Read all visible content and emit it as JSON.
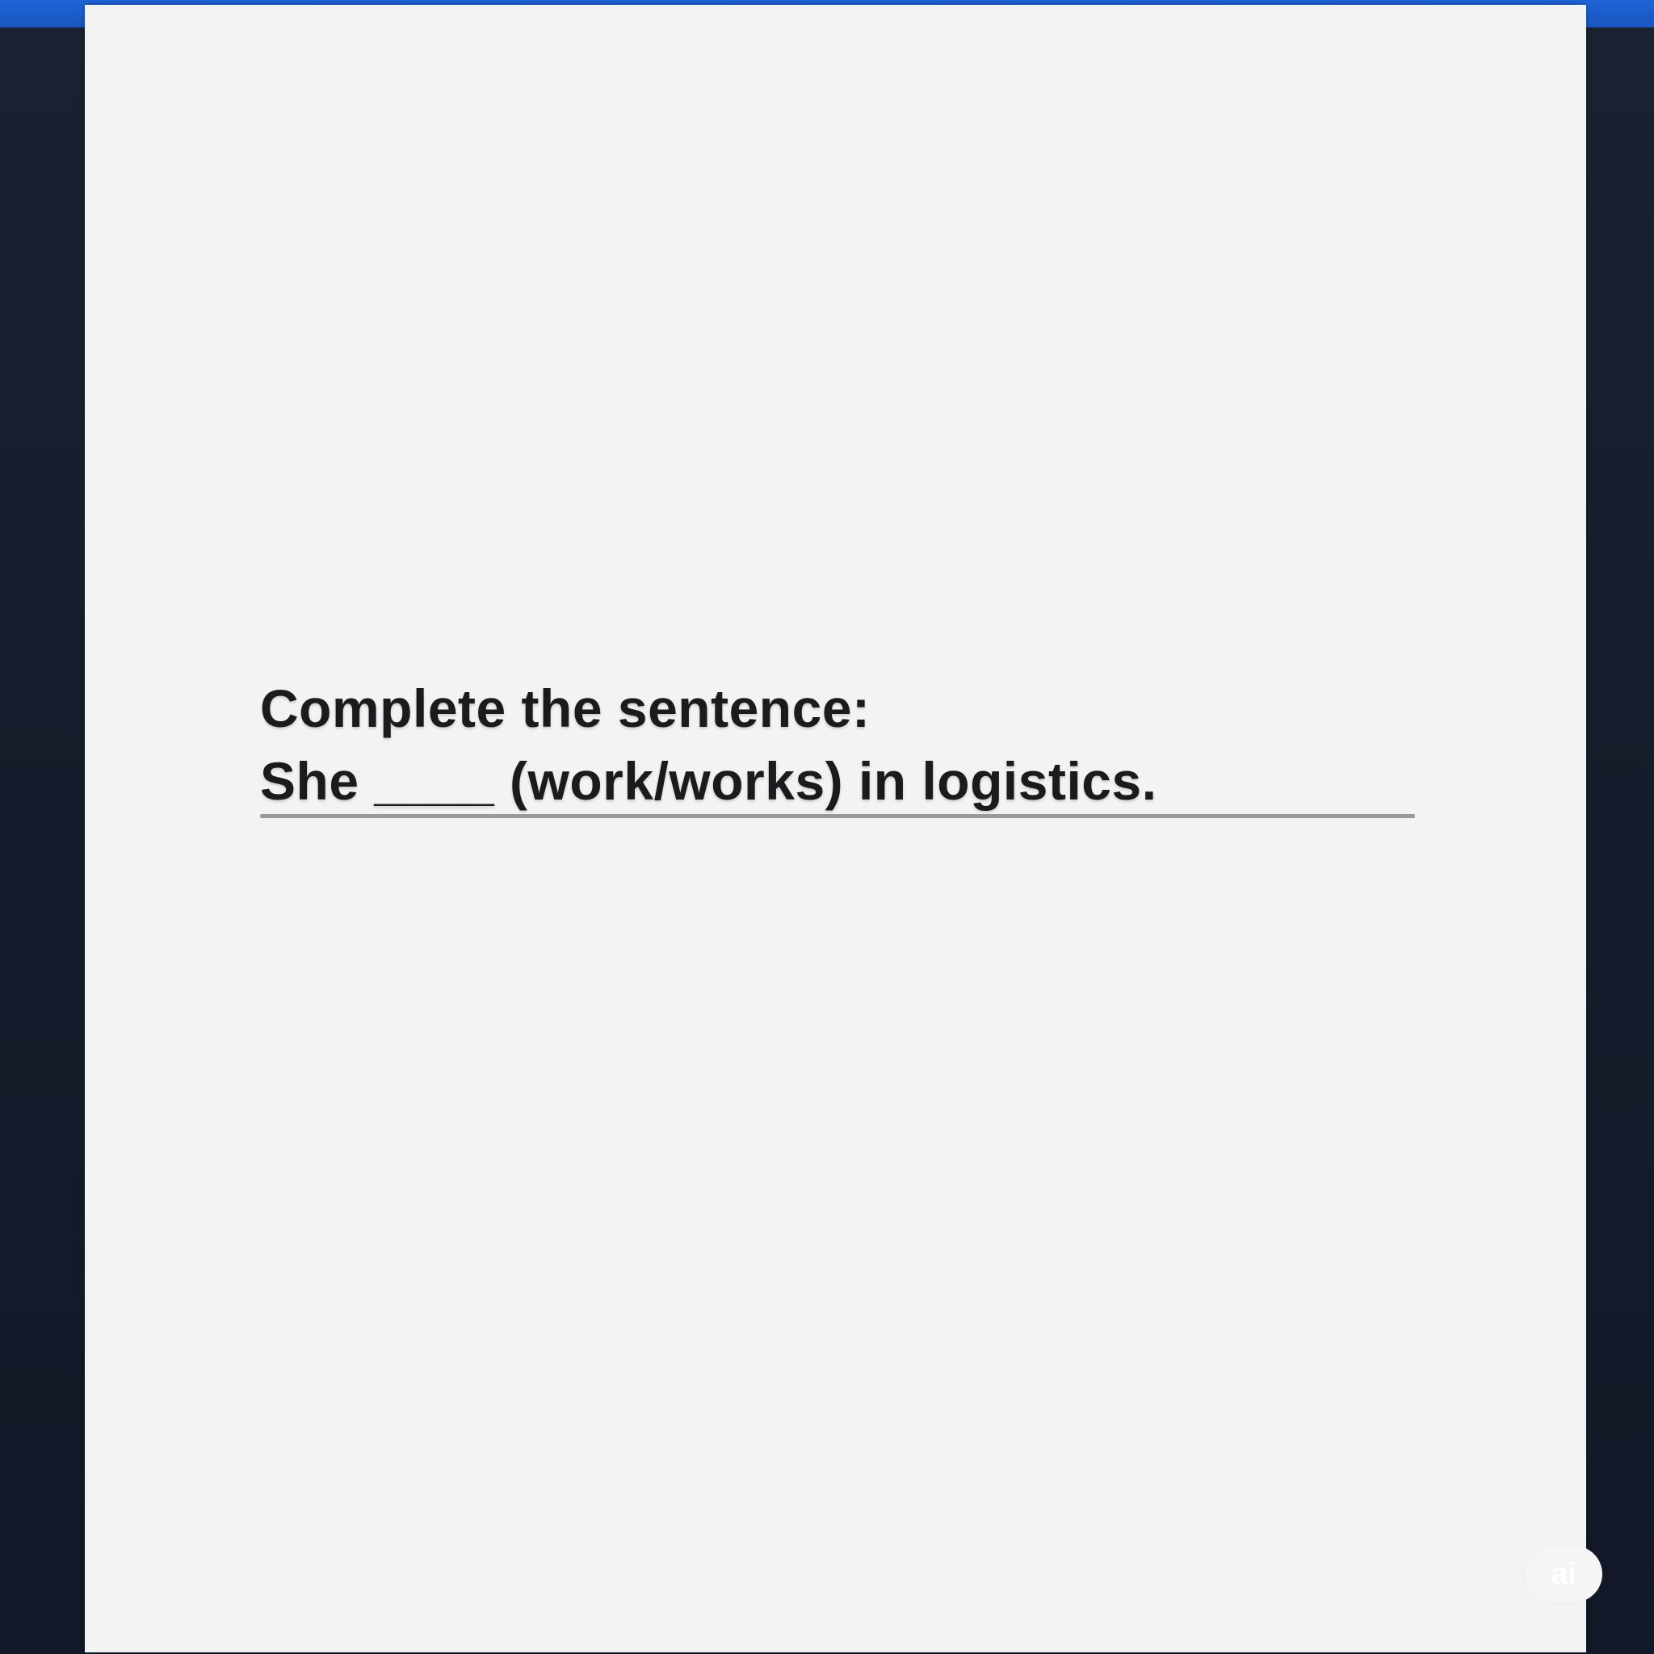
{
  "exercise": {
    "instruction": "Complete the sentence:",
    "sentence": "She ____ (work/works) in logistics."
  },
  "badge": {
    "label": "ai"
  },
  "colors": {
    "accent_bar": "#1e63d6",
    "background": "#151d2c",
    "page": "#f3f3f3",
    "text": "#1b1b1d",
    "answer_line": "#9a9a9a"
  }
}
